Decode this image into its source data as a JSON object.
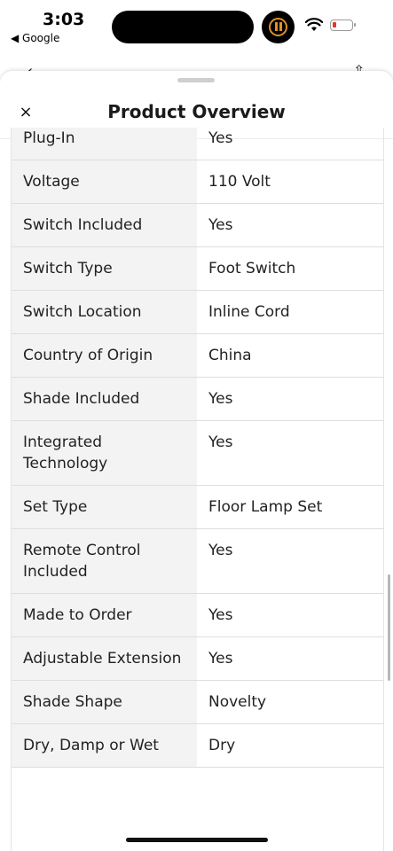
{
  "status_bar": {
    "time": "3:03",
    "back_app": "◀ Google"
  },
  "sheet": {
    "close_glyph": "×",
    "title": "Product Overview"
  },
  "specs": [
    {
      "label": "Plug-In",
      "value": "Yes"
    },
    {
      "label": "Voltage",
      "value": "110 Volt"
    },
    {
      "label": "Switch Included",
      "value": "Yes"
    },
    {
      "label": "Switch Type",
      "value": "Foot Switch"
    },
    {
      "label": "Switch Location",
      "value": "Inline Cord"
    },
    {
      "label": "Country of Origin",
      "value": "China"
    },
    {
      "label": "Shade Included",
      "value": "Yes"
    },
    {
      "label": "Integrated Technology",
      "value": "Yes"
    },
    {
      "label": "Set Type",
      "value": "Floor Lamp Set"
    },
    {
      "label": "Remote Control Included",
      "value": "Yes"
    },
    {
      "label": "Made to Order",
      "value": "Yes"
    },
    {
      "label": "Adjustable Extension",
      "value": "Yes"
    },
    {
      "label": "Shade Shape",
      "value": "Novelty"
    },
    {
      "label": "Dry, Damp or Wet",
      "value": "Dry"
    }
  ],
  "colors": {
    "label_background": "#f3f3f3",
    "divider": "#dedede",
    "battery_low": "#e0382e",
    "media_accent": "#e0902a"
  }
}
